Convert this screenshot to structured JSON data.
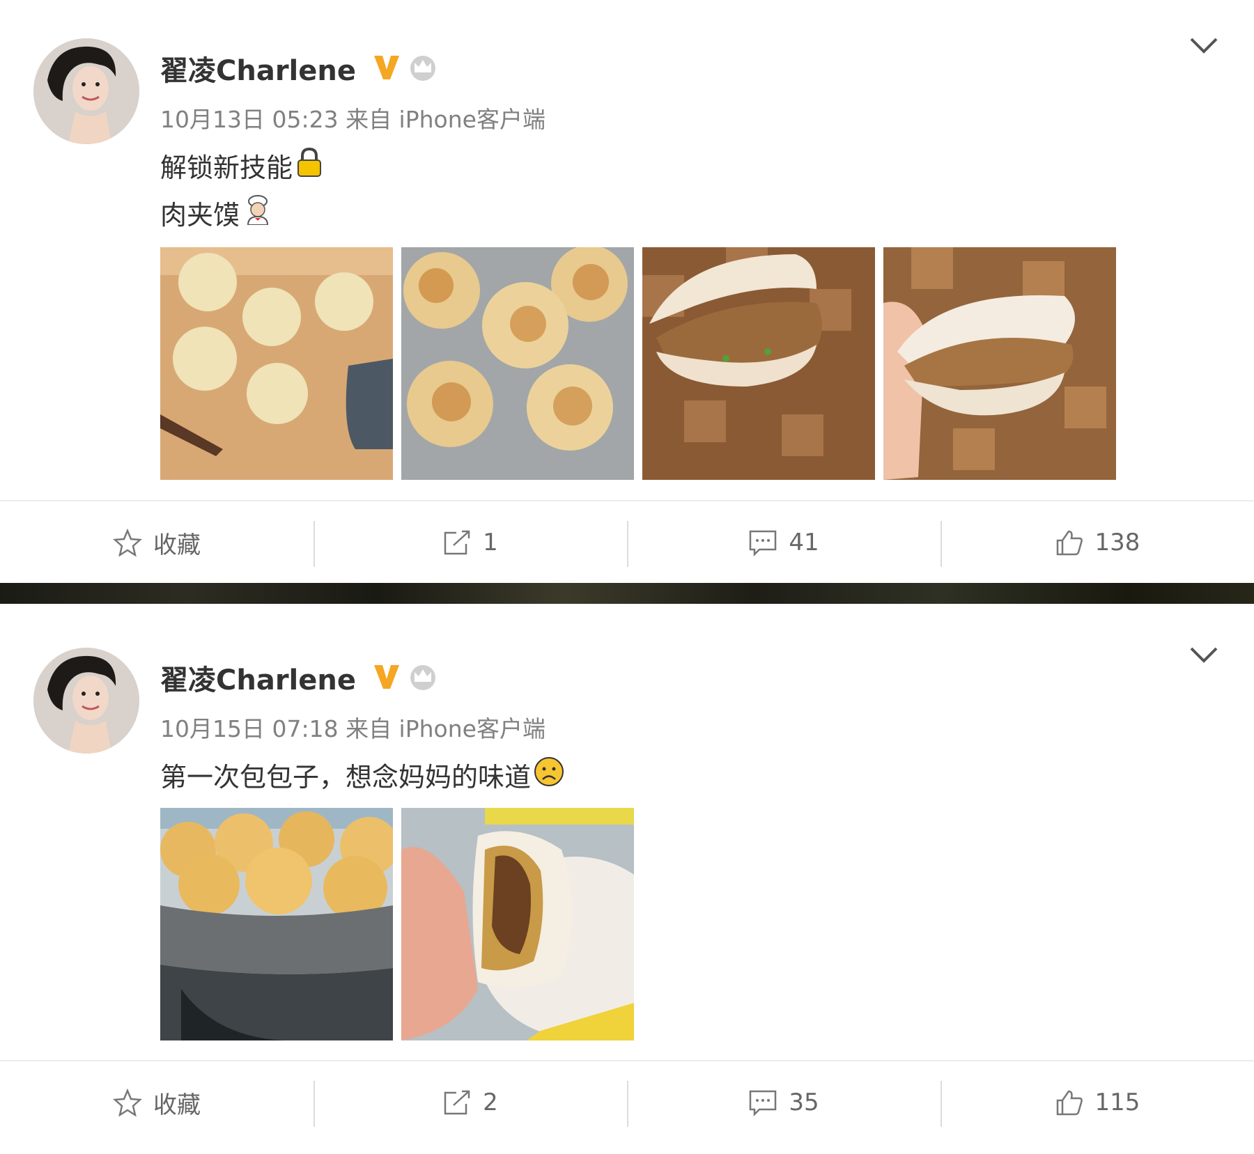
{
  "posts": [
    {
      "author": "翟凌Charlene",
      "meta": "10月13日 05:23 来自 iPhone客户端",
      "lines": [
        "解锁新技能",
        "肉夹馍"
      ],
      "line_emojis": [
        "lock-emoji",
        "chef-emoji"
      ],
      "images": [
        "dough-rounds-on-board",
        "pan-fried-flatbreads",
        "roujiamo-sandwich",
        "roujiamo-in-hand"
      ],
      "actions": {
        "favorite_label": "收藏",
        "repost_count": "1",
        "comment_count": "41",
        "like_count": "138"
      }
    },
    {
      "author": "翟凌Charlene",
      "meta": "10月15日 07:18 来自 iPhone客户端",
      "lines": [
        "第一次包包子，想念妈妈的味道"
      ],
      "line_emojis": [
        "sad-face-emoji"
      ],
      "images": [
        "steamed-buns-in-steamer",
        "bun-bitten-in-hand"
      ],
      "actions": {
        "favorite_label": "收藏",
        "repost_count": "2",
        "comment_count": "35",
        "like_count": "115"
      }
    }
  ],
  "colors": {
    "verified_badge": "#f5a623",
    "meta_text": "#808080",
    "action_text": "#666666"
  }
}
